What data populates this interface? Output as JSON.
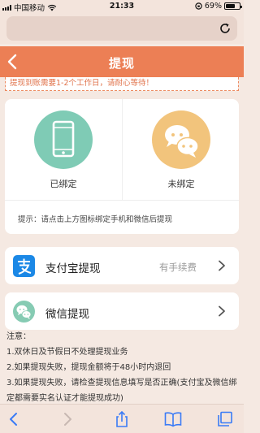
{
  "status_bar": {
    "carrier": "中国移动",
    "time": "21:33",
    "battery": "69%",
    "battery_level": 0.69
  },
  "header": {
    "title": "提现"
  },
  "notice": {
    "text": "提现到账需要1-2个工作日，请耐心等待！"
  },
  "bind": {
    "phone_label": "已绑定",
    "wechat_label": "未绑定",
    "hint": "提示：请点击上方图标绑定手机和微信后提现",
    "phone_color": "#7fcbb5",
    "wechat_color": "#f2c47c"
  },
  "options": {
    "alipay": {
      "label": "支付宝提现",
      "fee": "有手续费",
      "icon": "alipay-icon"
    },
    "wechat": {
      "label": "微信提现",
      "icon": "wechat-icon"
    }
  },
  "notes": {
    "title": "注意：",
    "items": [
      "1.双休日及节假日不处理提现业务",
      "2.如果提现失败，提现金额将于48小时内退回",
      "3.如果提现失败，请检查提现信息填写是否正确(支付宝及微信绑定都需要实名认证才能提现成功)"
    ]
  },
  "colors": {
    "accent": "#ec7f55",
    "background": "#f5e9e2",
    "toolbar_blue": "#3a7bf6"
  }
}
